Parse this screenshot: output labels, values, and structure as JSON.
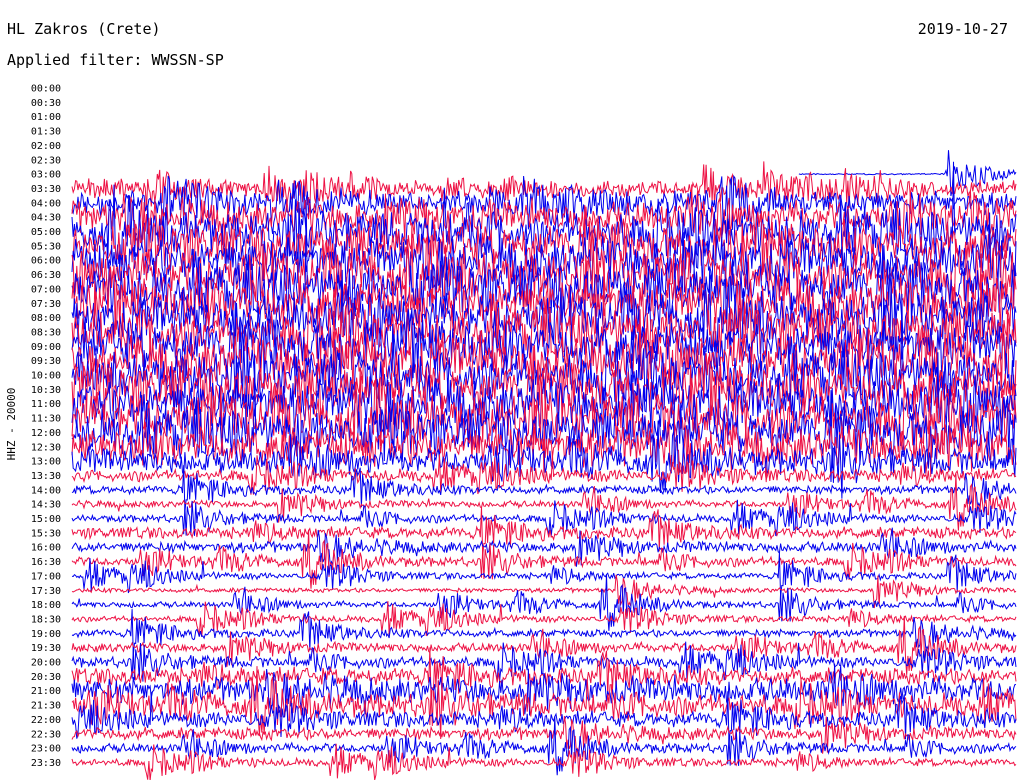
{
  "header": {
    "station": "HL Zakros (Crete)",
    "date": "2019-10-27",
    "filter": "Applied filter: WWSSN-SP"
  },
  "chart_data": {
    "type": "line",
    "ylabel": "HHZ - 20000",
    "time_labels": [
      "00:00",
      "00:30",
      "01:00",
      "01:30",
      "02:00",
      "02:30",
      "03:00",
      "03:30",
      "04:00",
      "04:30",
      "05:00",
      "05:30",
      "06:00",
      "06:30",
      "07:00",
      "07:30",
      "08:00",
      "08:30",
      "09:00",
      "09:30",
      "10:00",
      "10:30",
      "11:00",
      "11:30",
      "12:00",
      "12:30",
      "13:00",
      "13:30",
      "14:00",
      "14:30",
      "15:00",
      "15:30",
      "16:00",
      "16:30",
      "17:00",
      "17:30",
      "18:00",
      "18:30",
      "19:00",
      "19:30",
      "20:00",
      "20:30",
      "21:00",
      "21:30",
      "22:00",
      "22:30",
      "23:00",
      "23:30"
    ],
    "colors": [
      "#0000ee",
      "#ee1144"
    ],
    "trace_start_row": 7,
    "trace_start_fraction": 0.77,
    "relative_amplitude": [
      0,
      0,
      0,
      0,
      0,
      0,
      0,
      0.9,
      1.4,
      1.9,
      2.4,
      2.5,
      2.7,
      2.8,
      3.0,
      2.9,
      2.7,
      2.8,
      3.0,
      2.9,
      2.8,
      2.8,
      2.9,
      2.9,
      2.7,
      2.4,
      1.6,
      0.7,
      0.45,
      0.35,
      0.4,
      0.65,
      0.6,
      0.5,
      0.3,
      0.2,
      0.3,
      0.3,
      0.4,
      0.5,
      0.6,
      1.0,
      1.6,
      1.4,
      0.9,
      0.7,
      0.5,
      0.4
    ]
  }
}
